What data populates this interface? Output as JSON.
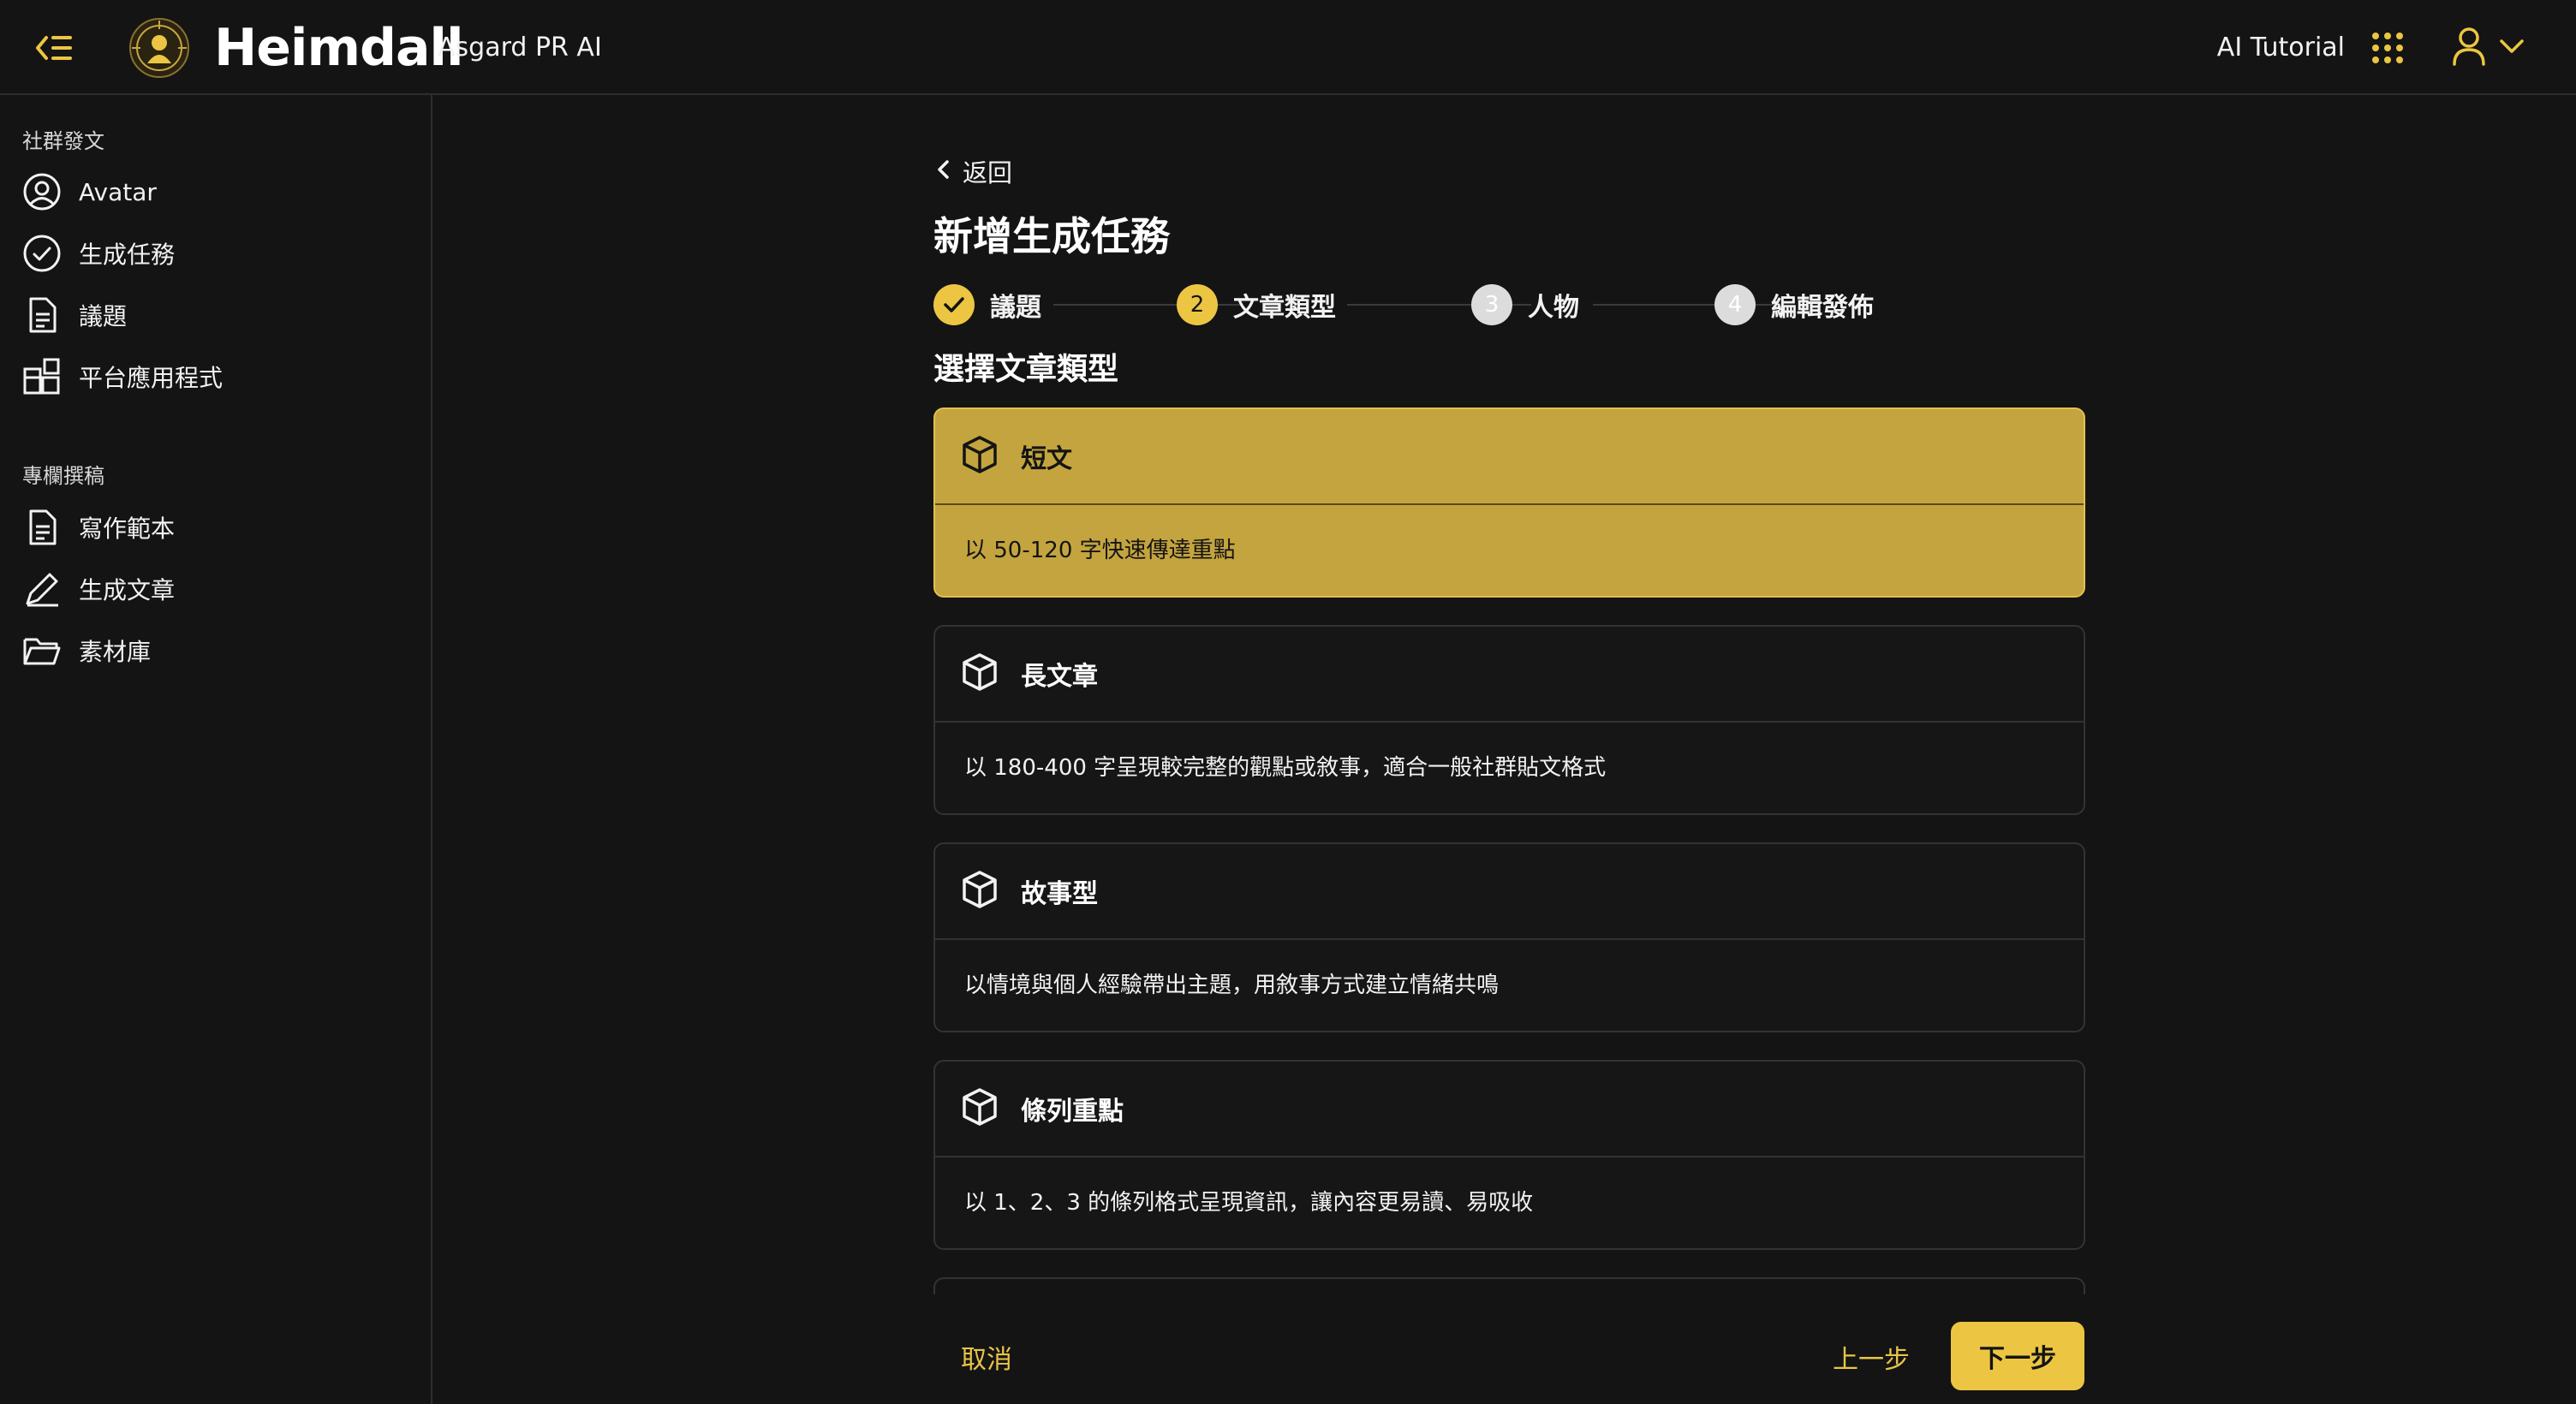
{
  "header": {
    "brand": "Heimdall",
    "brand_sub": "Asgard PR AI",
    "tutorial": "AI Tutorial"
  },
  "colors": {
    "accent": "#ecc642",
    "selected_card": "#c4a43e",
    "background": "#141414",
    "border": "#333333"
  },
  "sidebar": {
    "sections": [
      {
        "label": "社群發文",
        "items": [
          {
            "label": "Avatar",
            "icon": "user-circle-icon"
          },
          {
            "label": "生成任務",
            "icon": "check-circle-icon"
          },
          {
            "label": "議題",
            "icon": "document-icon"
          },
          {
            "label": "平台應用程式",
            "icon": "apps-grid-icon"
          }
        ]
      },
      {
        "label": "專欄撰稿",
        "items": [
          {
            "label": "寫作範本",
            "icon": "document-icon"
          },
          {
            "label": "生成文章",
            "icon": "pen-icon"
          },
          {
            "label": "素材庫",
            "icon": "folder-icon"
          }
        ]
      }
    ]
  },
  "main": {
    "back": "返回",
    "title": "新增生成任務",
    "steps": [
      {
        "number": "1",
        "label": "議題",
        "state": "done"
      },
      {
        "number": "2",
        "label": "文章類型",
        "state": "current"
      },
      {
        "number": "3",
        "label": "人物",
        "state": "pending"
      },
      {
        "number": "4",
        "label": "編輯發佈",
        "state": "pending"
      }
    ],
    "section_title": "選擇文章類型",
    "options": [
      {
        "title": "短文",
        "desc": "以 50-120 字快速傳達重點",
        "selected": true,
        "icon": "cube-icon"
      },
      {
        "title": "長文章",
        "desc": "以 180-400 字呈現較完整的觀點或敘事，適合一般社群貼文格式",
        "selected": false,
        "icon": "cube-icon"
      },
      {
        "title": "故事型",
        "desc": "以情境與個人經驗帶出主題，用敘事方式建立情緒共鳴",
        "selected": false,
        "icon": "cube-icon"
      },
      {
        "title": "條列重點",
        "desc": "以 1、2、3 的條列格式呈現資訊，讓內容更易讀、易吸收",
        "selected": false,
        "icon": "cube-icon"
      }
    ]
  },
  "footer": {
    "cancel": "取消",
    "prev": "上一步",
    "next": "下一步"
  }
}
